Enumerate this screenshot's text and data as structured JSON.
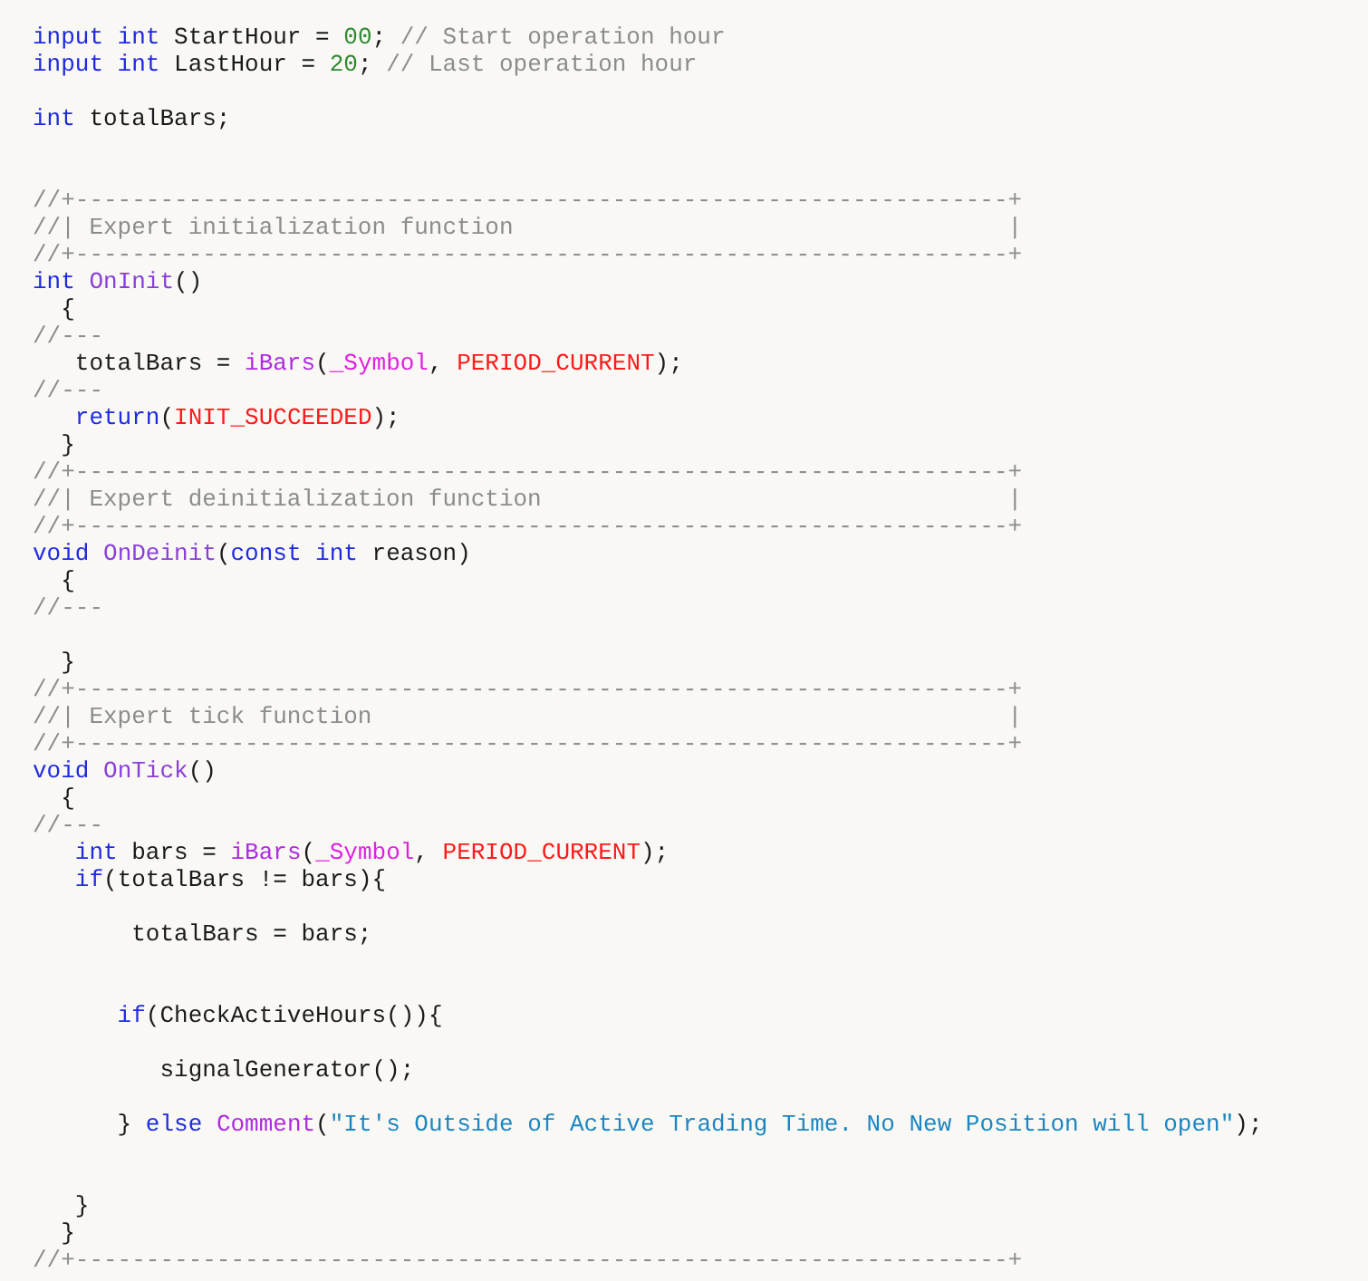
{
  "code_lines": [
    {
      "kind": "code",
      "tokens": [
        {
          "kind": "keyword",
          "text": "input int"
        },
        {
          "kind": "plain",
          "text": " StartHour = "
        },
        {
          "kind": "number",
          "text": "00"
        },
        {
          "kind": "plain",
          "text": "; "
        },
        {
          "kind": "comment",
          "text": "// Start operation hour"
        }
      ]
    },
    {
      "kind": "code",
      "tokens": [
        {
          "kind": "keyword",
          "text": "input int"
        },
        {
          "kind": "plain",
          "text": " LastHour = "
        },
        {
          "kind": "number",
          "text": "20"
        },
        {
          "kind": "plain",
          "text": "; "
        },
        {
          "kind": "comment",
          "text": "// Last operation hour"
        }
      ]
    },
    {
      "kind": "blank"
    },
    {
      "kind": "code",
      "tokens": [
        {
          "kind": "keyword",
          "text": "int"
        },
        {
          "kind": "plain",
          "text": " totalBars;"
        }
      ]
    },
    {
      "kind": "blank"
    },
    {
      "kind": "blank"
    },
    {
      "kind": "code",
      "tokens": [
        {
          "kind": "comment",
          "text": "//+------------------------------------------------------------------+"
        }
      ]
    },
    {
      "kind": "code",
      "tokens": [
        {
          "kind": "comment",
          "text": "//| Expert initialization function                                   |"
        }
      ]
    },
    {
      "kind": "code",
      "tokens": [
        {
          "kind": "comment",
          "text": "//+------------------------------------------------------------------+"
        }
      ]
    },
    {
      "kind": "code",
      "tokens": [
        {
          "kind": "keyword",
          "text": "int "
        },
        {
          "kind": "function",
          "text": "OnInit"
        },
        {
          "kind": "plain",
          "text": "()"
        }
      ]
    },
    {
      "kind": "code",
      "tokens": [
        {
          "kind": "plain",
          "text": "  {"
        }
      ]
    },
    {
      "kind": "code",
      "tokens": [
        {
          "kind": "comment",
          "text": "//---"
        }
      ]
    },
    {
      "kind": "code",
      "tokens": [
        {
          "kind": "plain",
          "text": "   totalBars = "
        },
        {
          "kind": "builtin",
          "text": "iBars"
        },
        {
          "kind": "plain",
          "text": "("
        },
        {
          "kind": "predefined",
          "text": "_Symbol"
        },
        {
          "kind": "plain",
          "text": ", "
        },
        {
          "kind": "constant",
          "text": "PERIOD_CURRENT"
        },
        {
          "kind": "plain",
          "text": ");"
        }
      ]
    },
    {
      "kind": "code",
      "tokens": [
        {
          "kind": "comment",
          "text": "//---"
        }
      ]
    },
    {
      "kind": "code",
      "tokens": [
        {
          "kind": "keyword",
          "text": "   return"
        },
        {
          "kind": "plain",
          "text": "("
        },
        {
          "kind": "constant",
          "text": "INIT_SUCCEEDED"
        },
        {
          "kind": "plain",
          "text": ");"
        }
      ]
    },
    {
      "kind": "code",
      "tokens": [
        {
          "kind": "plain",
          "text": "  }"
        }
      ]
    },
    {
      "kind": "code",
      "tokens": [
        {
          "kind": "comment",
          "text": "//+------------------------------------------------------------------+"
        }
      ]
    },
    {
      "kind": "code",
      "tokens": [
        {
          "kind": "comment",
          "text": "//| Expert deinitialization function                                 |"
        }
      ]
    },
    {
      "kind": "code",
      "tokens": [
        {
          "kind": "comment",
          "text": "//+------------------------------------------------------------------+"
        }
      ]
    },
    {
      "kind": "code",
      "tokens": [
        {
          "kind": "keyword",
          "text": "void "
        },
        {
          "kind": "function",
          "text": "OnDeinit"
        },
        {
          "kind": "plain",
          "text": "("
        },
        {
          "kind": "keyword",
          "text": "const int"
        },
        {
          "kind": "plain",
          "text": " reason)"
        }
      ]
    },
    {
      "kind": "code",
      "tokens": [
        {
          "kind": "plain",
          "text": "  {"
        }
      ]
    },
    {
      "kind": "code",
      "tokens": [
        {
          "kind": "comment",
          "text": "//---"
        }
      ]
    },
    {
      "kind": "blank"
    },
    {
      "kind": "code",
      "tokens": [
        {
          "kind": "plain",
          "text": "  }"
        }
      ]
    },
    {
      "kind": "code",
      "tokens": [
        {
          "kind": "comment",
          "text": "//+------------------------------------------------------------------+"
        }
      ]
    },
    {
      "kind": "code",
      "tokens": [
        {
          "kind": "comment",
          "text": "//| Expert tick function                                             |"
        }
      ]
    },
    {
      "kind": "code",
      "tokens": [
        {
          "kind": "comment",
          "text": "//+------------------------------------------------------------------+"
        }
      ]
    },
    {
      "kind": "code",
      "tokens": [
        {
          "kind": "keyword",
          "text": "void "
        },
        {
          "kind": "function",
          "text": "OnTick"
        },
        {
          "kind": "plain",
          "text": "()"
        }
      ]
    },
    {
      "kind": "code",
      "tokens": [
        {
          "kind": "plain",
          "text": "  {"
        }
      ]
    },
    {
      "kind": "code",
      "tokens": [
        {
          "kind": "comment",
          "text": "//---"
        }
      ]
    },
    {
      "kind": "code",
      "tokens": [
        {
          "kind": "keyword",
          "text": "   int"
        },
        {
          "kind": "plain",
          "text": " bars = "
        },
        {
          "kind": "builtin",
          "text": "iBars"
        },
        {
          "kind": "plain",
          "text": "("
        },
        {
          "kind": "predefined",
          "text": "_Symbol"
        },
        {
          "kind": "plain",
          "text": ", "
        },
        {
          "kind": "constant",
          "text": "PERIOD_CURRENT"
        },
        {
          "kind": "plain",
          "text": ");"
        }
      ]
    },
    {
      "kind": "code",
      "tokens": [
        {
          "kind": "keyword",
          "text": "   if"
        },
        {
          "kind": "plain",
          "text": "(totalBars != bars){"
        }
      ]
    },
    {
      "kind": "blank"
    },
    {
      "kind": "code",
      "tokens": [
        {
          "kind": "plain",
          "text": "       totalBars = bars;"
        }
      ]
    },
    {
      "kind": "blank"
    },
    {
      "kind": "blank"
    },
    {
      "kind": "code",
      "tokens": [
        {
          "kind": "keyword",
          "text": "      if"
        },
        {
          "kind": "plain",
          "text": "(CheckActiveHours()){"
        }
      ]
    },
    {
      "kind": "blank"
    },
    {
      "kind": "code",
      "tokens": [
        {
          "kind": "plain",
          "text": "         signalGenerator();"
        }
      ]
    },
    {
      "kind": "blank"
    },
    {
      "kind": "code",
      "tokens": [
        {
          "kind": "plain",
          "text": "      } "
        },
        {
          "kind": "keyword",
          "text": "else "
        },
        {
          "kind": "builtin",
          "text": "Comment"
        },
        {
          "kind": "plain",
          "text": "("
        },
        {
          "kind": "string",
          "text": "\"It's Outside of Active Trading Time. No New Position will open\""
        },
        {
          "kind": "plain",
          "text": ");"
        }
      ]
    },
    {
      "kind": "blank"
    },
    {
      "kind": "blank"
    },
    {
      "kind": "code",
      "tokens": [
        {
          "kind": "plain",
          "text": "   }"
        }
      ]
    },
    {
      "kind": "code",
      "tokens": [
        {
          "kind": "plain",
          "text": "  }"
        }
      ]
    },
    {
      "kind": "code",
      "tokens": [
        {
          "kind": "comment",
          "text": "//+------------------------------------------------------------------+"
        }
      ]
    }
  ]
}
